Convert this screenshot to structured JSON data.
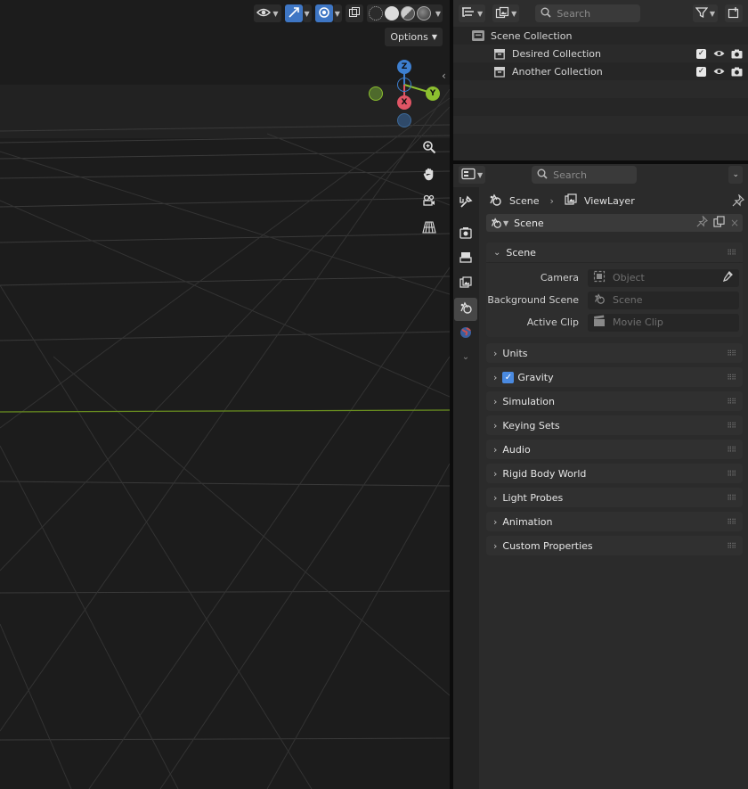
{
  "viewport": {
    "options_label": "Options",
    "gizmo": {
      "z": "Z",
      "x": "X",
      "y": "Y"
    }
  },
  "outliner": {
    "search_placeholder": "Search",
    "root": "Scene Collection",
    "collections": [
      {
        "name": "Desired Collection"
      },
      {
        "name": "Another Collection"
      }
    ]
  },
  "properties": {
    "search_placeholder": "Search",
    "breadcrumb": {
      "scene": "Scene",
      "view_layer": "ViewLayer"
    },
    "datablock": "Scene",
    "scene_panel": {
      "title": "Scene",
      "camera_label": "Camera",
      "camera_placeholder": "Object",
      "background_label": "Background Scene",
      "background_placeholder": "Scene",
      "clip_label": "Active Clip",
      "clip_placeholder": "Movie Clip"
    },
    "panels": {
      "units": "Units",
      "gravity": "Gravity",
      "simulation": "Simulation",
      "keying_sets": "Keying Sets",
      "audio": "Audio",
      "rigid_body_world": "Rigid Body World",
      "light_probes": "Light Probes",
      "animation": "Animation",
      "custom_properties": "Custom Properties"
    }
  },
  "colors": {
    "accent": "#4a8ae0",
    "axis_x": "#e05565",
    "axis_y": "#8cbf2f",
    "axis_z": "#3d7fd0"
  }
}
